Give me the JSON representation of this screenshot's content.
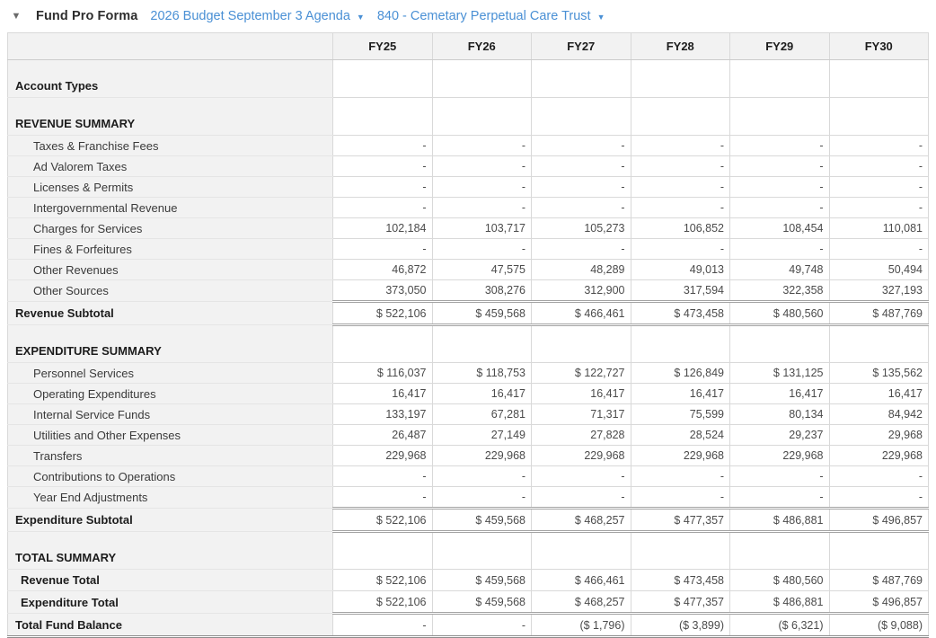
{
  "colors": {
    "link_blue": "#4a90d5",
    "panel_gray": "#f2f2f2"
  },
  "header": {
    "collapse_caret": "▼",
    "title": "Fund Pro Forma",
    "dropdowns": [
      {
        "label": "2026 Budget September 3 Agenda",
        "caret": "▼"
      },
      {
        "label": "840 - Cemetary Perpetual Care Trust",
        "caret": "▼"
      }
    ]
  },
  "table": {
    "columns": [
      "FY25",
      "FY26",
      "FY27",
      "FY28",
      "FY29",
      "FY30"
    ],
    "rows": [
      {
        "label": "Account Types",
        "type": "section",
        "values": [
          "",
          "",
          "",
          "",
          "",
          ""
        ]
      },
      {
        "label": "REVENUE SUMMARY",
        "type": "section",
        "values": [
          "",
          "",
          "",
          "",
          "",
          ""
        ]
      },
      {
        "label": "Taxes & Franchise Fees",
        "type": "detail",
        "values": [
          "-",
          "-",
          "-",
          "-",
          "-",
          "-"
        ]
      },
      {
        "label": "Ad Valorem Taxes",
        "type": "detail",
        "values": [
          "-",
          "-",
          "-",
          "-",
          "-",
          "-"
        ]
      },
      {
        "label": "Licenses & Permits",
        "type": "detail",
        "values": [
          "-",
          "-",
          "-",
          "-",
          "-",
          "-"
        ]
      },
      {
        "label": "Intergovernmental Revenue",
        "type": "detail",
        "values": [
          "-",
          "-",
          "-",
          "-",
          "-",
          "-"
        ]
      },
      {
        "label": "Charges for Services",
        "type": "detail",
        "values": [
          "102,184",
          "103,717",
          "105,273",
          "106,852",
          "108,454",
          "110,081"
        ]
      },
      {
        "label": "Fines & Forfeitures",
        "type": "detail",
        "values": [
          "-",
          "-",
          "-",
          "-",
          "-",
          "-"
        ]
      },
      {
        "label": "Other Revenues",
        "type": "detail",
        "values": [
          "46,872",
          "47,575",
          "48,289",
          "49,013",
          "49,748",
          "50,494"
        ]
      },
      {
        "label": "Other Sources",
        "type": "detail",
        "values": [
          "373,050",
          "308,276",
          "312,900",
          "317,594",
          "322,358",
          "327,193"
        ]
      },
      {
        "label": "Revenue Subtotal",
        "type": "subtotal",
        "values": [
          "$ 522,106",
          "$ 459,568",
          "$ 466,461",
          "$ 473,458",
          "$ 480,560",
          "$ 487,769"
        ]
      },
      {
        "label": "EXPENDITURE SUMMARY",
        "type": "section",
        "values": [
          "",
          "",
          "",
          "",
          "",
          ""
        ]
      },
      {
        "label": "Personnel Services",
        "type": "detail",
        "values": [
          "$ 116,037",
          "$ 118,753",
          "$ 122,727",
          "$ 126,849",
          "$ 131,125",
          "$ 135,562"
        ]
      },
      {
        "label": "Operating Expenditures",
        "type": "detail",
        "values": [
          "16,417",
          "16,417",
          "16,417",
          "16,417",
          "16,417",
          "16,417"
        ]
      },
      {
        "label": "Internal Service Funds",
        "type": "detail",
        "values": [
          "133,197",
          "67,281",
          "71,317",
          "75,599",
          "80,134",
          "84,942"
        ]
      },
      {
        "label": "Utilities and Other Expenses",
        "type": "detail",
        "values": [
          "26,487",
          "27,149",
          "27,828",
          "28,524",
          "29,237",
          "29,968"
        ]
      },
      {
        "label": "Transfers",
        "type": "detail",
        "values": [
          "229,968",
          "229,968",
          "229,968",
          "229,968",
          "229,968",
          "229,968"
        ]
      },
      {
        "label": "Contributions to Operations",
        "type": "detail",
        "values": [
          "-",
          "-",
          "-",
          "-",
          "-",
          "-"
        ]
      },
      {
        "label": "Year End Adjustments",
        "type": "detail",
        "values": [
          "-",
          "-",
          "-",
          "-",
          "-",
          "-"
        ]
      },
      {
        "label": "Expenditure Subtotal",
        "type": "subtotal",
        "values": [
          "$ 522,106",
          "$ 459,568",
          "$ 468,257",
          "$ 477,357",
          "$ 486,881",
          "$ 496,857"
        ]
      },
      {
        "label": "TOTAL SUMMARY",
        "type": "section",
        "values": [
          "",
          "",
          "",
          "",
          "",
          ""
        ]
      },
      {
        "label": "Revenue Total",
        "type": "total",
        "values": [
          "$ 522,106",
          "$ 459,568",
          "$ 466,461",
          "$ 473,458",
          "$ 480,560",
          "$ 487,769"
        ]
      },
      {
        "label": "Expenditure Total",
        "type": "total",
        "values": [
          "$ 522,106",
          "$ 459,568",
          "$ 468,257",
          "$ 477,357",
          "$ 486,881",
          "$ 496,857"
        ]
      },
      {
        "label": "Total Fund Balance",
        "type": "grand",
        "values": [
          "-",
          "-",
          "($ 1,796)",
          "($ 3,899)",
          "($ 6,321)",
          "($ 9,088)"
        ]
      }
    ]
  }
}
